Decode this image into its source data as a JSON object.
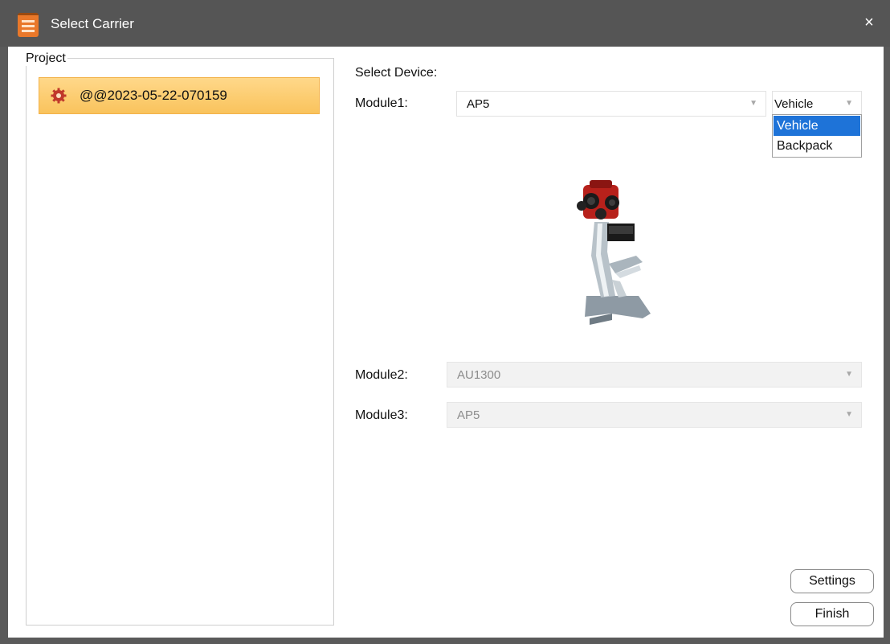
{
  "window": {
    "title": "Select Carrier",
    "close_glyph": "×"
  },
  "project": {
    "label": "Project",
    "items": [
      {
        "name": "@@2023-05-22-070159",
        "icon": "gear-icon"
      }
    ]
  },
  "device": {
    "section_label": "Select Device:",
    "module1": {
      "label": "Module1:",
      "value": "AP5"
    },
    "carrier": {
      "value": "Vehicle",
      "options": [
        "Vehicle",
        "Backpack"
      ],
      "selected": "Vehicle"
    },
    "module2": {
      "label": "Module2:",
      "value": "AU1300"
    },
    "module3": {
      "label": "Module3:",
      "value": "AP5"
    }
  },
  "buttons": {
    "settings": "Settings",
    "finish": "Finish"
  },
  "colors": {
    "titlebar": "#555555",
    "selection_orange": "#f9c35c",
    "dropdown_selected": "#1e73d8",
    "gear": "#c0392b"
  }
}
